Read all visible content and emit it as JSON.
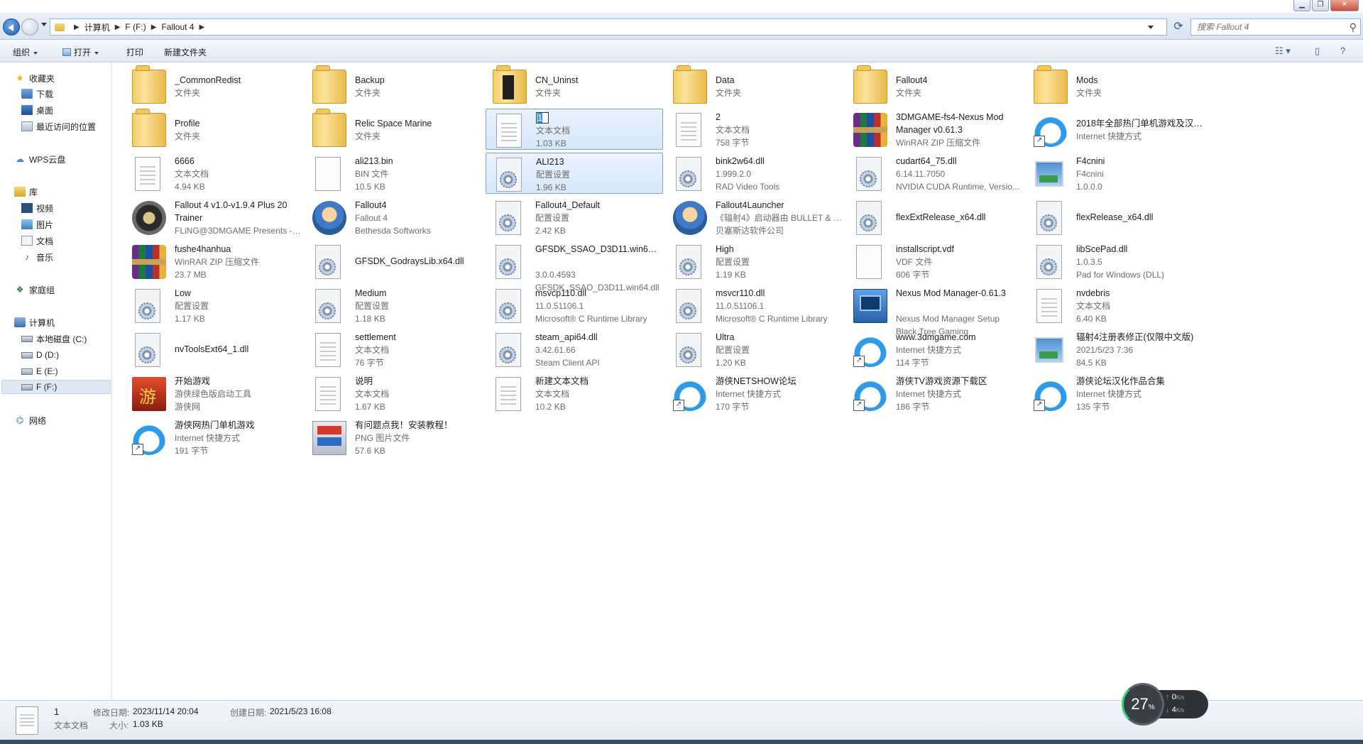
{
  "window": {
    "controls": [
      "▁",
      "❐",
      "✕"
    ]
  },
  "address": {
    "breadcrumbs": [
      "计算机",
      "F (F:)",
      "Fallout 4"
    ],
    "search_placeholder": "搜索 Fallout 4"
  },
  "toolbar": {
    "organize": "组织",
    "open": "打开",
    "print": "打印",
    "new_folder": "新建文件夹"
  },
  "sidebar": {
    "favorites": "收藏夹",
    "downloads": "下载",
    "desktop": "桌面",
    "recent": "最近访问的位置",
    "wps_cloud": "WPS云盘",
    "libraries": "库",
    "videos": "视频",
    "pictures": "图片",
    "documents": "文档",
    "music": "音乐",
    "homegroup": "家庭组",
    "computer": "计算机",
    "drive_c": "本地磁盘 (C:)",
    "drive_d": "D (D:)",
    "drive_e": "E (E:)",
    "drive_f": "F (F:)",
    "network": "网络"
  },
  "files": [
    {
      "name": "_CommonRedist",
      "l2": "文件夹",
      "l3": "",
      "icon": "folder-icon"
    },
    {
      "name": "Backup",
      "l2": "文件夹",
      "l3": "",
      "icon": "folder-icon"
    },
    {
      "name": "CN_Uninst",
      "l2": "文件夹",
      "l3": "",
      "icon": "folder-icon"
    },
    {
      "name": "Data",
      "l2": "文件夹",
      "l3": "",
      "icon": "folder-icon"
    },
    {
      "name": "Fallout4",
      "l2": "文件夹",
      "l3": "",
      "icon": "folder-icon"
    },
    {
      "name": "Mods",
      "l2": "文件夹",
      "l3": "",
      "icon": "folder-icon"
    },
    {
      "name": "Profile",
      "l2": "文件夹",
      "l3": "",
      "icon": "folder-icon"
    },
    {
      "name": "Relic Space Marine",
      "l2": "文件夹",
      "l3": "",
      "icon": "folder-icon"
    },
    {
      "name": "1",
      "l2": "文本文档",
      "l3": "1.03 KB",
      "icon": "text-document-icon"
    },
    {
      "name": "2",
      "l2": "文本文档",
      "l3": "758 字节",
      "icon": "text-document-icon"
    },
    {
      "name": "3DMGAME-fs4-Nexus Mod Manager v0.61.3",
      "l2": "WinRAR ZIP 压缩文件",
      "l3": "",
      "icon": "winrar-archive-icon"
    },
    {
      "name": "2018年全部热门单机游戏及汉化下载",
      "l2": "Internet 快捷方式",
      "l3": "",
      "icon": "internet-shortcut-icon"
    },
    {
      "name": "6666",
      "l2": "文本文档",
      "l3": "4.94 KB",
      "icon": "text-document-icon"
    },
    {
      "name": "ali213.bin",
      "l2": "BIN 文件",
      "l3": "10.5 KB",
      "icon": "blank-file-icon"
    },
    {
      "name": "ALI213",
      "l2": "配置设置",
      "l3": "1.96 KB",
      "icon": "config-settings-icon"
    },
    {
      "name": "bink2w64.dll",
      "l2": "1.999.2.0",
      "l3": "RAD Video Tools",
      "icon": "dll-gear-icon"
    },
    {
      "name": "cudart64_75.dll",
      "l2": "6.14.11.7050",
      "l3": "NVIDIA CUDA Runtime, Versio...",
      "icon": "dll-gear-icon"
    },
    {
      "name": "F4cnini",
      "l2": "F4cnini",
      "l3": "1.0.0.0",
      "icon": "application-icon"
    },
    {
      "name": "Fallout 4 v1.0-v1.9.4 Plus 20 Trainer",
      "l2": "FLiNG@3DMGAME Presents - ...",
      "l3": "",
      "icon": "trainer-icon"
    },
    {
      "name": "Fallout4",
      "l2": "Fallout 4",
      "l3": "Bethesda Softworks",
      "icon": "vault-boy-icon"
    },
    {
      "name": "Fallout4_Default",
      "l2": "配置设置",
      "l3": "2.42 KB",
      "icon": "config-settings-icon"
    },
    {
      "name": "Fallout4Launcher",
      "l2": "《辐射4》启动器由 BULLET & K...",
      "l3": "贝塞斯达软件公司",
      "icon": "vault-boy-icon"
    },
    {
      "name": "flexExtRelease_x64.dll",
      "l2": "",
      "l3": "",
      "icon": "dll-gear-icon"
    },
    {
      "name": "flexRelease_x64.dll",
      "l2": "",
      "l3": "",
      "icon": "dll-gear-icon"
    },
    {
      "name": "fushe4hanhua",
      "l2": "WinRAR ZIP 压缩文件",
      "l3": "23.7 MB",
      "icon": "winrar-archive-icon"
    },
    {
      "name": "GFSDK_GodraysLib.x64.dll",
      "l2": "",
      "l3": "",
      "icon": "dll-gear-icon"
    },
    {
      "name": "GFSDK_SSAO_D3D11.win64.dll",
      "l2": "3.0.0.4593",
      "l3": "GFSDK_SSAO_D3D11.win64.dll",
      "icon": "dll-gear-icon"
    },
    {
      "name": "High",
      "l2": "配置设置",
      "l3": "1.19 KB",
      "icon": "config-settings-icon"
    },
    {
      "name": "installscript.vdf",
      "l2": "VDF 文件",
      "l3": "606 字节",
      "icon": "blank-file-icon"
    },
    {
      "name": "libScePad.dll",
      "l2": "1.0.3.5",
      "l3": "Pad for Windows (DLL)",
      "icon": "dll-gear-icon"
    },
    {
      "name": "Low",
      "l2": "配置设置",
      "l3": "1.17 KB",
      "icon": "config-settings-icon"
    },
    {
      "name": "Medium",
      "l2": "配置设置",
      "l3": "1.18 KB",
      "icon": "config-settings-icon"
    },
    {
      "name": "msvcp110.dll",
      "l2": "11.0.51106.1",
      "l3": "Microsoft® C Runtime Library",
      "icon": "dll-gear-icon"
    },
    {
      "name": "msvcr110.dll",
      "l2": "11.0.51106.1",
      "l3": "Microsoft® C Runtime Library",
      "icon": "dll-gear-icon"
    },
    {
      "name": "Nexus Mod Manager-0.61.3",
      "l2": "Nexus Mod Manager Setup",
      "l3": "Black Tree Gaming",
      "icon": "installer-icon"
    },
    {
      "name": "nvdebris",
      "l2": "文本文档",
      "l3": "6.40 KB",
      "icon": "text-document-icon"
    },
    {
      "name": "nvToolsExt64_1.dll",
      "l2": "",
      "l3": "",
      "icon": "dll-gear-icon"
    },
    {
      "name": "settlement",
      "l2": "文本文档",
      "l3": "76 字节",
      "icon": "text-document-icon"
    },
    {
      "name": "steam_api64.dll",
      "l2": "3.42.61.66",
      "l3": "Steam Client API",
      "icon": "dll-gear-icon"
    },
    {
      "name": "Ultra",
      "l2": "配置设置",
      "l3": "1.20 KB",
      "icon": "config-settings-icon"
    },
    {
      "name": "www.3dmgame.com",
      "l2": "Internet 快捷方式",
      "l3": "114 字节",
      "icon": "internet-shortcut-icon"
    },
    {
      "name": "辐射4注册表修正(仅限中文版)",
      "l2": "2021/5/23 7:36",
      "l3": "84.5 KB",
      "icon": "application-icon"
    },
    {
      "name": "开始游戏",
      "l2": "游侠绿色版启动工具",
      "l3": "游侠网",
      "icon": "game-launcher-icon"
    },
    {
      "name": "说明",
      "l2": "文本文档",
      "l3": "1.67 KB",
      "icon": "text-document-icon"
    },
    {
      "name": "新建文本文档",
      "l2": "文本文档",
      "l3": "10.2 KB",
      "icon": "text-document-icon"
    },
    {
      "name": "游侠NETSHOW论坛",
      "l2": "Internet 快捷方式",
      "l3": "170 字节",
      "icon": "internet-shortcut-icon"
    },
    {
      "name": "游侠TV游戏资源下载区",
      "l2": "Internet 快捷方式",
      "l3": "186 字节",
      "icon": "internet-shortcut-icon"
    },
    {
      "name": "游侠论坛汉化作品合集",
      "l2": "Internet 快捷方式",
      "l3": "135 字节",
      "icon": "internet-shortcut-icon"
    },
    {
      "name": "游侠网热门单机游戏",
      "l2": "Internet 快捷方式",
      "l3": "191 字节",
      "icon": "internet-shortcut-icon"
    },
    {
      "name": "有问题点我！安装教程！",
      "l2": "PNG 图片文件",
      "l3": "57.6 KB",
      "icon": "png-image-icon"
    }
  ],
  "status": {
    "name": "1",
    "type": "文本文档",
    "modified_label": "修改日期:",
    "modified_value": "2023/11/14 20:04",
    "created_label": "创建日期:",
    "created_value": "2021/5/23 16:08",
    "size_label": "大小:",
    "size_value": "1.03 KB"
  },
  "speed_widget": {
    "percent": "27",
    "percent_unit": "%",
    "up": "0",
    "up_unit": "K/s",
    "down": "4",
    "down_unit": "K/s"
  }
}
